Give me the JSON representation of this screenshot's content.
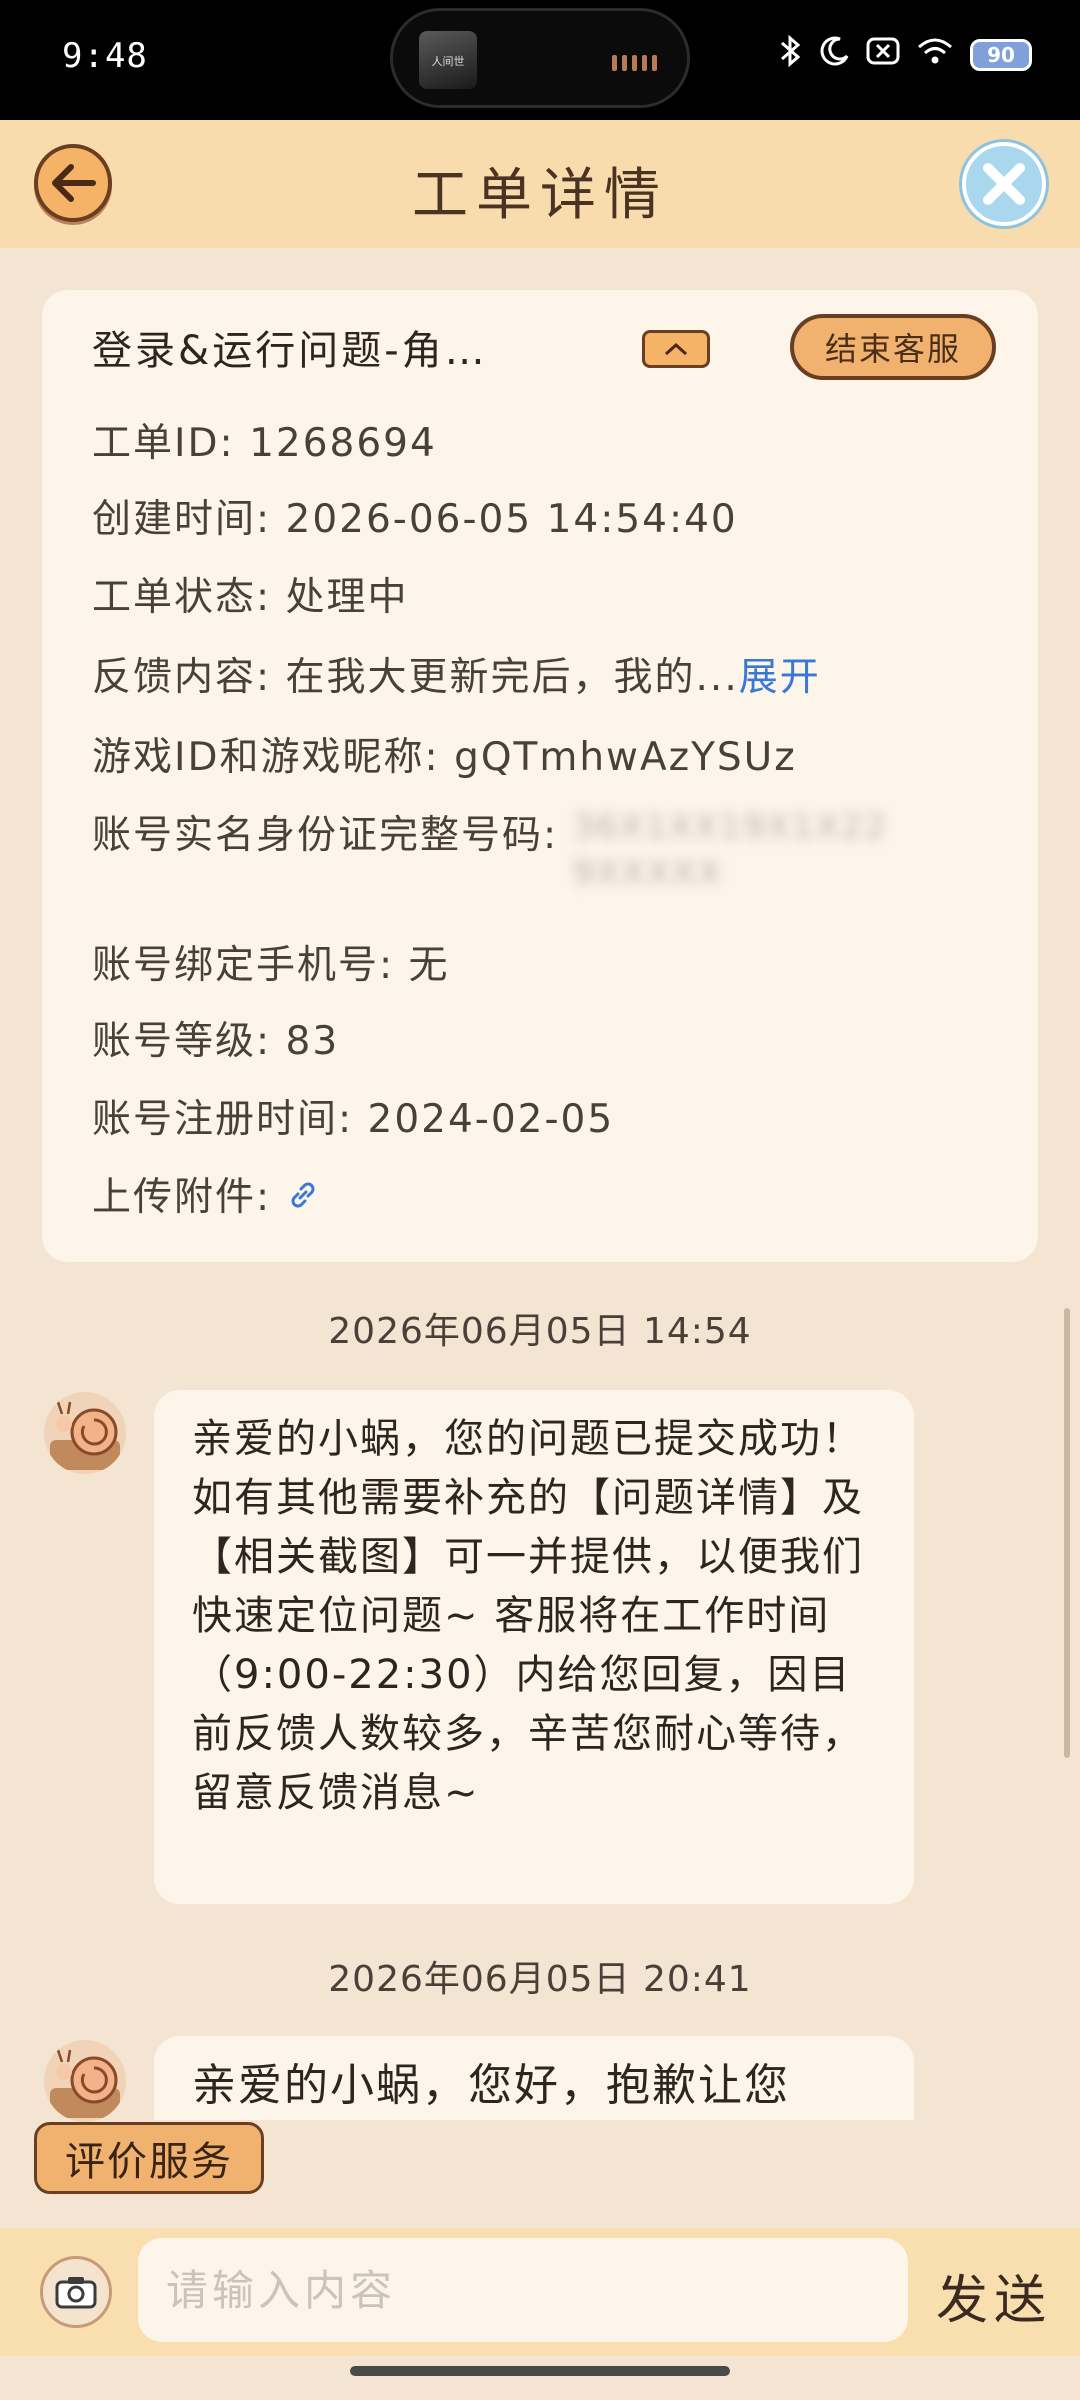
{
  "status_bar": {
    "time": "9:48",
    "battery": "90",
    "island_thumb_text": "人间世"
  },
  "header": {
    "title": "工单详情"
  },
  "ticket": {
    "title": "登录&运行问题-角…",
    "end_service": "结束客服",
    "id_line": "工单ID: 1268694",
    "created_line": "创建时间: 2026-06-05 14:54:40",
    "status_line": "工单状态: 处理中",
    "feedback_label": "反馈内容: 在我大更新完后，我的...",
    "expand": "展开",
    "game_id_line": "游戏ID和游戏昵称: gQTmhwAzYSUz",
    "idcard_label": "账号实名身份证完整号码: ",
    "idcard_value_blurred": "36X1XX19X1X22 9XXXXX",
    "phone_line": "账号绑定手机号: 无",
    "level_line": "账号等级: 83",
    "register_line": "账号注册时间: 2024-02-05",
    "attachment_label": "上传附件: "
  },
  "messages": [
    {
      "timestamp": "2026年06月05日 14:54",
      "text": "亲爱的小蜗，您的问题已提交成功！如有其他需要补充的【问题详情】及【相关截图】可一并提供，以便我们快速定位问题~ 客服将在工作时间（9:00-22:30）内给您回复，因目前反馈人数较多，辛苦您耐心等待，留意反馈消息~"
    },
    {
      "timestamp": "2026年06月05日 20:41",
      "text": "亲爱的小蜗，您好，抱歉让您"
    }
  ],
  "rate_button": "评价服务",
  "input": {
    "placeholder": "请输入内容",
    "send": "发送"
  }
}
